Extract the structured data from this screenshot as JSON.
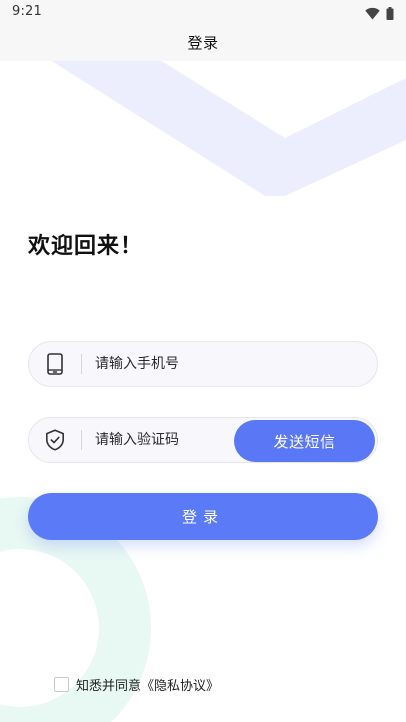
{
  "status_bar": {
    "time": "9:21",
    "icons": [
      "wifi-icon",
      "battery-icon"
    ]
  },
  "nav": {
    "title": "登录"
  },
  "welcome": {
    "text": "欢迎回来！"
  },
  "phone_field": {
    "icon": "phone-icon",
    "placeholder": "请输入手机号"
  },
  "code_field": {
    "icon": "shield-check-icon",
    "placeholder": "请输入验证码",
    "send_button": "发送短信"
  },
  "login_button": {
    "label": "登录"
  },
  "agreement": {
    "text": "知悉并同意《隐私协议》",
    "checked": false
  },
  "colors": {
    "primary": "#5b7af7",
    "deco_top": "#eceefe",
    "deco_bottom": "#e8f8f3"
  }
}
